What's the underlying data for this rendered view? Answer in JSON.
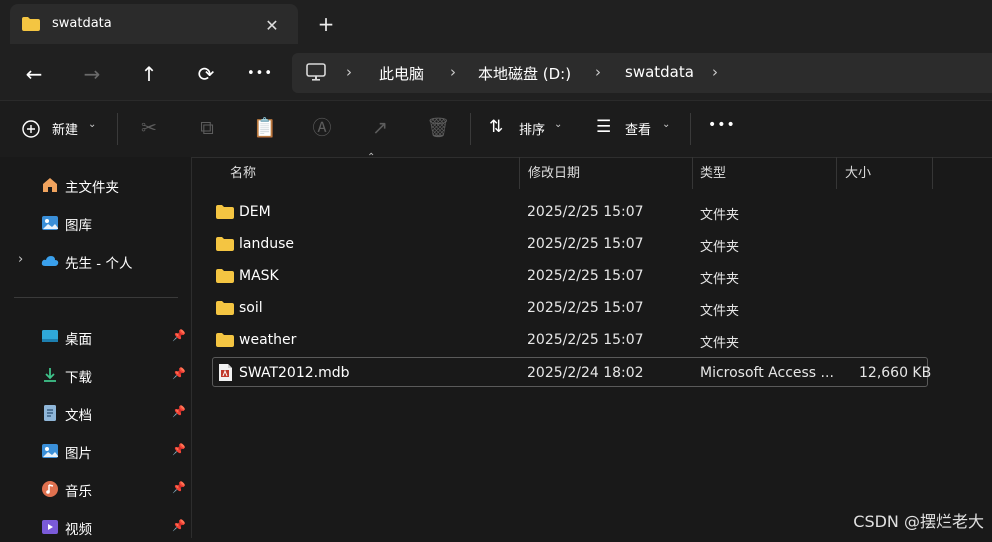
{
  "tab": {
    "title": "swatdata",
    "close": "✕",
    "new_tab": "+"
  },
  "nav": {
    "back": "←",
    "forward": "→",
    "up": "↑",
    "refresh": "⟳",
    "more": "•••"
  },
  "address": {
    "crumbs": [
      "此电脑",
      "本地磁盘 (D:)",
      "swatdata"
    ],
    "chevron": "›"
  },
  "commands": {
    "new_label": "新建",
    "sort_label": "排序",
    "view_label": "查看",
    "more": "•••"
  },
  "sidebar": {
    "items": [
      {
        "label": "主文件夹",
        "icon": "home-icon"
      },
      {
        "label": "图库",
        "icon": "gallery-icon"
      },
      {
        "label": "先生 - 个人",
        "icon": "onedrive-icon"
      }
    ],
    "pinned": [
      {
        "label": "桌面",
        "icon": "desktop-icon"
      },
      {
        "label": "下载",
        "icon": "download-icon"
      },
      {
        "label": "文档",
        "icon": "documents-icon"
      },
      {
        "label": "图片",
        "icon": "pictures-icon"
      },
      {
        "label": "音乐",
        "icon": "music-icon"
      },
      {
        "label": "视频",
        "icon": "videos-icon"
      }
    ]
  },
  "columns": {
    "name": "名称",
    "modified": "修改日期",
    "type": "类型",
    "size": "大小"
  },
  "files": [
    {
      "name": "DEM",
      "modified": "2025/2/25 15:07",
      "type": "文件夹",
      "size": ""
    },
    {
      "name": "landuse",
      "modified": "2025/2/25 15:07",
      "type": "文件夹",
      "size": ""
    },
    {
      "name": "MASK",
      "modified": "2025/2/25 15:07",
      "type": "文件夹",
      "size": ""
    },
    {
      "name": "soil",
      "modified": "2025/2/25 15:07",
      "type": "文件夹",
      "size": ""
    },
    {
      "name": "weather",
      "modified": "2025/2/25 15:07",
      "type": "文件夹",
      "size": ""
    },
    {
      "name": "SWAT2012.mdb",
      "modified": "2025/2/24 18:02",
      "type": "Microsoft Access ...",
      "size": "12,660 KB"
    }
  ],
  "watermark": "CSDN @摆烂老大",
  "colors": {
    "folder": "#f4c542",
    "accent": "#4aa3df",
    "bg": "#191919"
  }
}
